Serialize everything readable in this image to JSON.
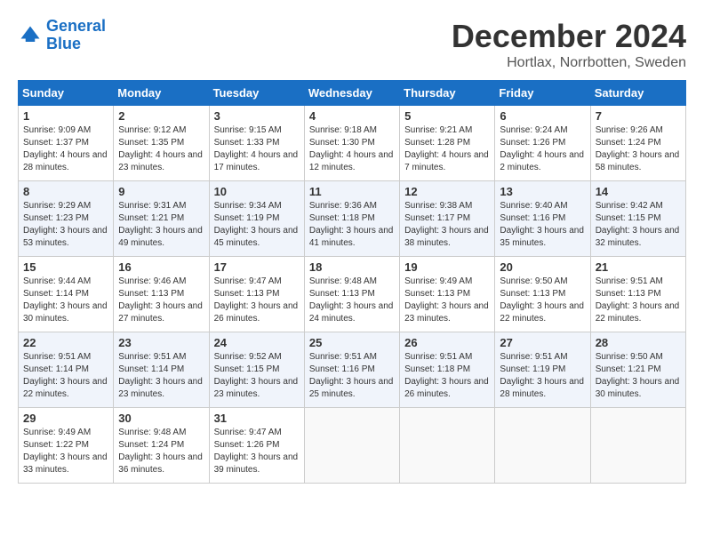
{
  "logo": {
    "line1": "General",
    "line2": "Blue"
  },
  "title": "December 2024",
  "location": "Hortlax, Norrbotten, Sweden",
  "headers": [
    "Sunday",
    "Monday",
    "Tuesday",
    "Wednesday",
    "Thursday",
    "Friday",
    "Saturday"
  ],
  "weeks": [
    [
      {
        "day": "1",
        "sunrise": "9:09 AM",
        "sunset": "1:37 PM",
        "daylight": "4 hours and 28 minutes."
      },
      {
        "day": "2",
        "sunrise": "9:12 AM",
        "sunset": "1:35 PM",
        "daylight": "4 hours and 23 minutes."
      },
      {
        "day": "3",
        "sunrise": "9:15 AM",
        "sunset": "1:33 PM",
        "daylight": "4 hours and 17 minutes."
      },
      {
        "day": "4",
        "sunrise": "9:18 AM",
        "sunset": "1:30 PM",
        "daylight": "4 hours and 12 minutes."
      },
      {
        "day": "5",
        "sunrise": "9:21 AM",
        "sunset": "1:28 PM",
        "daylight": "4 hours and 7 minutes."
      },
      {
        "day": "6",
        "sunrise": "9:24 AM",
        "sunset": "1:26 PM",
        "daylight": "4 hours and 2 minutes."
      },
      {
        "day": "7",
        "sunrise": "9:26 AM",
        "sunset": "1:24 PM",
        "daylight": "3 hours and 58 minutes."
      }
    ],
    [
      {
        "day": "8",
        "sunrise": "9:29 AM",
        "sunset": "1:23 PM",
        "daylight": "3 hours and 53 minutes."
      },
      {
        "day": "9",
        "sunrise": "9:31 AM",
        "sunset": "1:21 PM",
        "daylight": "3 hours and 49 minutes."
      },
      {
        "day": "10",
        "sunrise": "9:34 AM",
        "sunset": "1:19 PM",
        "daylight": "3 hours and 45 minutes."
      },
      {
        "day": "11",
        "sunrise": "9:36 AM",
        "sunset": "1:18 PM",
        "daylight": "3 hours and 41 minutes."
      },
      {
        "day": "12",
        "sunrise": "9:38 AM",
        "sunset": "1:17 PM",
        "daylight": "3 hours and 38 minutes."
      },
      {
        "day": "13",
        "sunrise": "9:40 AM",
        "sunset": "1:16 PM",
        "daylight": "3 hours and 35 minutes."
      },
      {
        "day": "14",
        "sunrise": "9:42 AM",
        "sunset": "1:15 PM",
        "daylight": "3 hours and 32 minutes."
      }
    ],
    [
      {
        "day": "15",
        "sunrise": "9:44 AM",
        "sunset": "1:14 PM",
        "daylight": "3 hours and 30 minutes."
      },
      {
        "day": "16",
        "sunrise": "9:46 AM",
        "sunset": "1:13 PM",
        "daylight": "3 hours and 27 minutes."
      },
      {
        "day": "17",
        "sunrise": "9:47 AM",
        "sunset": "1:13 PM",
        "daylight": "3 hours and 26 minutes."
      },
      {
        "day": "18",
        "sunrise": "9:48 AM",
        "sunset": "1:13 PM",
        "daylight": "3 hours and 24 minutes."
      },
      {
        "day": "19",
        "sunrise": "9:49 AM",
        "sunset": "1:13 PM",
        "daylight": "3 hours and 23 minutes."
      },
      {
        "day": "20",
        "sunrise": "9:50 AM",
        "sunset": "1:13 PM",
        "daylight": "3 hours and 22 minutes."
      },
      {
        "day": "21",
        "sunrise": "9:51 AM",
        "sunset": "1:13 PM",
        "daylight": "3 hours and 22 minutes."
      }
    ],
    [
      {
        "day": "22",
        "sunrise": "9:51 AM",
        "sunset": "1:14 PM",
        "daylight": "3 hours and 22 minutes."
      },
      {
        "day": "23",
        "sunrise": "9:51 AM",
        "sunset": "1:14 PM",
        "daylight": "3 hours and 23 minutes."
      },
      {
        "day": "24",
        "sunrise": "9:52 AM",
        "sunset": "1:15 PM",
        "daylight": "3 hours and 23 minutes."
      },
      {
        "day": "25",
        "sunrise": "9:51 AM",
        "sunset": "1:16 PM",
        "daylight": "3 hours and 25 minutes."
      },
      {
        "day": "26",
        "sunrise": "9:51 AM",
        "sunset": "1:18 PM",
        "daylight": "3 hours and 26 minutes."
      },
      {
        "day": "27",
        "sunrise": "9:51 AM",
        "sunset": "1:19 PM",
        "daylight": "3 hours and 28 minutes."
      },
      {
        "day": "28",
        "sunrise": "9:50 AM",
        "sunset": "1:21 PM",
        "daylight": "3 hours and 30 minutes."
      }
    ],
    [
      {
        "day": "29",
        "sunrise": "9:49 AM",
        "sunset": "1:22 PM",
        "daylight": "3 hours and 33 minutes."
      },
      {
        "day": "30",
        "sunrise": "9:48 AM",
        "sunset": "1:24 PM",
        "daylight": "3 hours and 36 minutes."
      },
      {
        "day": "31",
        "sunrise": "9:47 AM",
        "sunset": "1:26 PM",
        "daylight": "3 hours and 39 minutes."
      },
      null,
      null,
      null,
      null
    ]
  ],
  "labels": {
    "sunrise": "Sunrise:",
    "sunset": "Sunset:",
    "daylight": "Daylight:"
  }
}
